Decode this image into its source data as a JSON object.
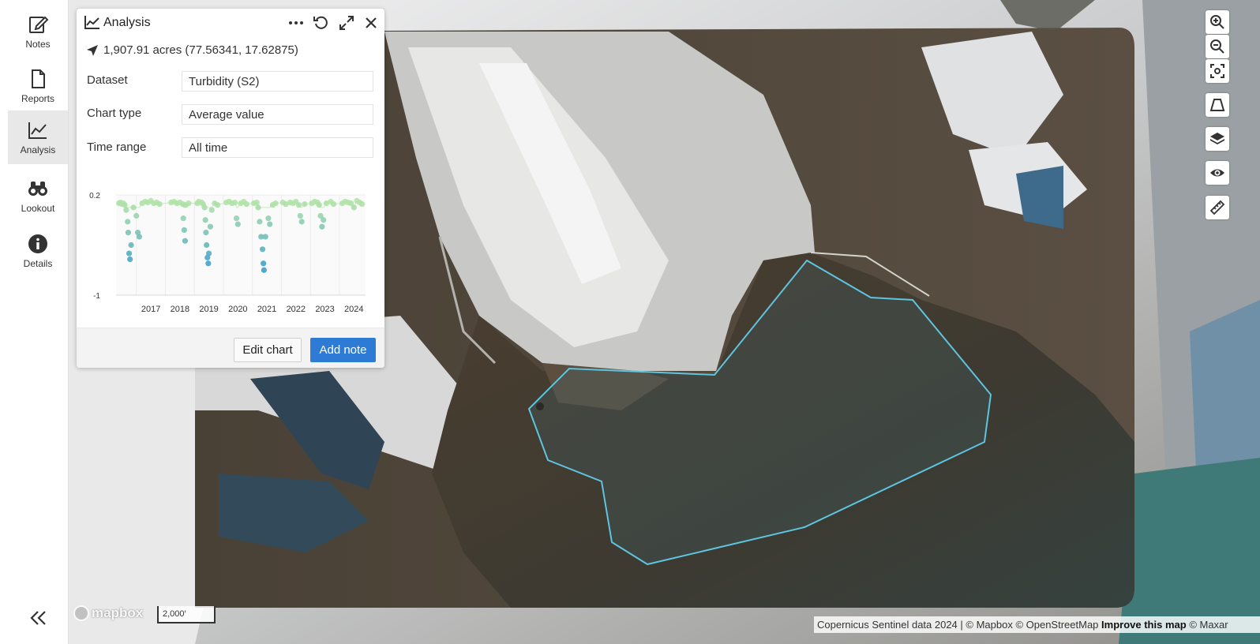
{
  "nav": {
    "items": [
      {
        "label": "Notes",
        "icon": "notes-icon"
      },
      {
        "label": "Reports",
        "icon": "report-icon"
      },
      {
        "label": "Analysis",
        "icon": "chart-line-icon",
        "active": true
      },
      {
        "label": "Lookout",
        "icon": "binoculars-icon"
      },
      {
        "label": "Details",
        "icon": "info-icon"
      }
    ],
    "collapse_icon": "double-chevron-left-icon"
  },
  "panel": {
    "title": "Analysis",
    "area_text": "1,907.91 acres (77.56341, 17.62875)",
    "fields": [
      {
        "label": "Dataset",
        "value": "Turbidity (S2)"
      },
      {
        "label": "Chart type",
        "value": "Average value"
      },
      {
        "label": "Time range",
        "value": "All time"
      }
    ],
    "edit_chart_label": "Edit chart",
    "add_note_label": "Add note",
    "header_icons": [
      "more-icon",
      "reset-icon",
      "expand-icon",
      "close-icon"
    ]
  },
  "chart_data": {
    "type": "scatter",
    "title": "",
    "xlabel": "",
    "ylabel": "",
    "ylim": [
      -1,
      0.2
    ],
    "xlim": [
      2016.3,
      2024.9
    ],
    "y_ticks": [
      "0.2",
      "-1"
    ],
    "x_ticks": [
      "2017",
      "2018",
      "2019",
      "2020",
      "2021",
      "2022",
      "2023",
      "2024"
    ],
    "colors": {
      "high": "#b7e6a6",
      "low": "#3ea0c9",
      "grid": "#ececec"
    },
    "grid": true,
    "points": [
      {
        "x": 2016.4,
        "y": 0.1
      },
      {
        "x": 2016.45,
        "y": 0.11
      },
      {
        "x": 2016.5,
        "y": 0.09
      },
      {
        "x": 2016.55,
        "y": 0.1
      },
      {
        "x": 2016.6,
        "y": 0.08
      },
      {
        "x": 2016.65,
        "y": 0.02
      },
      {
        "x": 2016.7,
        "y": -0.12
      },
      {
        "x": 2016.72,
        "y": -0.25
      },
      {
        "x": 2016.75,
        "y": -0.5
      },
      {
        "x": 2016.78,
        "y": -0.57
      },
      {
        "x": 2016.82,
        "y": -0.4
      },
      {
        "x": 2016.9,
        "y": 0.05
      },
      {
        "x": 2017.0,
        "y": -0.05
      },
      {
        "x": 2017.05,
        "y": -0.25
      },
      {
        "x": 2017.1,
        "y": -0.3
      },
      {
        "x": 2017.2,
        "y": 0.1
      },
      {
        "x": 2017.3,
        "y": 0.12
      },
      {
        "x": 2017.4,
        "y": 0.11
      },
      {
        "x": 2017.5,
        "y": 0.13
      },
      {
        "x": 2017.6,
        "y": 0.1
      },
      {
        "x": 2017.7,
        "y": 0.11
      },
      {
        "x": 2017.8,
        "y": 0.09
      },
      {
        "x": 2018.2,
        "y": 0.11
      },
      {
        "x": 2018.3,
        "y": 0.12
      },
      {
        "x": 2018.4,
        "y": 0.1
      },
      {
        "x": 2018.5,
        "y": 0.11
      },
      {
        "x": 2018.6,
        "y": 0.09
      },
      {
        "x": 2018.62,
        "y": -0.08
      },
      {
        "x": 2018.65,
        "y": -0.22
      },
      {
        "x": 2018.68,
        "y": -0.35
      },
      {
        "x": 2018.7,
        "y": 0.08
      },
      {
        "x": 2018.8,
        "y": 0.1
      },
      {
        "x": 2019.1,
        "y": 0.1
      },
      {
        "x": 2019.15,
        "y": 0.12
      },
      {
        "x": 2019.25,
        "y": 0.11
      },
      {
        "x": 2019.3,
        "y": 0.09
      },
      {
        "x": 2019.35,
        "y": 0.05
      },
      {
        "x": 2019.38,
        "y": -0.1
      },
      {
        "x": 2019.4,
        "y": -0.25
      },
      {
        "x": 2019.42,
        "y": -0.4
      },
      {
        "x": 2019.45,
        "y": -0.55
      },
      {
        "x": 2019.48,
        "y": -0.62
      },
      {
        "x": 2019.5,
        "y": -0.5
      },
      {
        "x": 2019.55,
        "y": -0.18
      },
      {
        "x": 2019.6,
        "y": 0.02
      },
      {
        "x": 2019.7,
        "y": 0.1
      },
      {
        "x": 2019.8,
        "y": 0.08
      },
      {
        "x": 2020.1,
        "y": 0.11
      },
      {
        "x": 2020.2,
        "y": 0.12
      },
      {
        "x": 2020.3,
        "y": 0.1
      },
      {
        "x": 2020.4,
        "y": 0.11
      },
      {
        "x": 2020.45,
        "y": -0.08
      },
      {
        "x": 2020.5,
        "y": -0.15
      },
      {
        "x": 2020.6,
        "y": 0.1
      },
      {
        "x": 2020.7,
        "y": 0.12
      },
      {
        "x": 2020.8,
        "y": 0.09
      },
      {
        "x": 2021.05,
        "y": 0.1
      },
      {
        "x": 2021.15,
        "y": 0.11
      },
      {
        "x": 2021.2,
        "y": 0.05
      },
      {
        "x": 2021.25,
        "y": -0.12
      },
      {
        "x": 2021.3,
        "y": -0.3
      },
      {
        "x": 2021.35,
        "y": -0.45
      },
      {
        "x": 2021.38,
        "y": -0.62
      },
      {
        "x": 2021.4,
        "y": -0.7
      },
      {
        "x": 2021.45,
        "y": -0.3
      },
      {
        "x": 2021.55,
        "y": -0.08
      },
      {
        "x": 2021.6,
        "y": -0.15
      },
      {
        "x": 2021.7,
        "y": 0.08
      },
      {
        "x": 2021.8,
        "y": 0.1
      },
      {
        "x": 2022.05,
        "y": 0.11
      },
      {
        "x": 2022.15,
        "y": 0.09
      },
      {
        "x": 2022.3,
        "y": 0.11
      },
      {
        "x": 2022.4,
        "y": 0.1
      },
      {
        "x": 2022.5,
        "y": 0.12
      },
      {
        "x": 2022.6,
        "y": 0.08
      },
      {
        "x": 2022.65,
        "y": -0.05
      },
      {
        "x": 2022.7,
        "y": -0.12
      },
      {
        "x": 2022.8,
        "y": 0.09
      },
      {
        "x": 2023.05,
        "y": 0.1
      },
      {
        "x": 2023.15,
        "y": 0.12
      },
      {
        "x": 2023.25,
        "y": 0.11
      },
      {
        "x": 2023.3,
        "y": 0.08
      },
      {
        "x": 2023.35,
        "y": -0.05
      },
      {
        "x": 2023.4,
        "y": -0.18
      },
      {
        "x": 2023.45,
        "y": -0.1
      },
      {
        "x": 2023.55,
        "y": 0.1
      },
      {
        "x": 2023.7,
        "y": 0.12
      },
      {
        "x": 2023.8,
        "y": 0.09
      },
      {
        "x": 2024.1,
        "y": 0.1
      },
      {
        "x": 2024.2,
        "y": 0.12
      },
      {
        "x": 2024.3,
        "y": 0.11
      },
      {
        "x": 2024.4,
        "y": 0.1
      },
      {
        "x": 2024.5,
        "y": 0.05
      },
      {
        "x": 2024.6,
        "y": 0.13
      },
      {
        "x": 2024.7,
        "y": 0.11
      },
      {
        "x": 2024.78,
        "y": 0.09
      }
    ]
  },
  "map": {
    "polygon_color": "#5ec4e0",
    "toolbar": [
      {
        "icon": "zoom-in-icon"
      },
      {
        "icon": "zoom-out-icon"
      },
      {
        "icon": "fit-bounds-icon"
      },
      {
        "icon": "perspective-icon"
      },
      {
        "icon": "layers-icon"
      },
      {
        "icon": "eye-icon"
      },
      {
        "icon": "ruler-icon"
      }
    ],
    "scale_label": "2,000′",
    "logo": "mapbox",
    "attribution": "Copernicus Sentinel data 2024 | © Mapbox © OpenStreetMap",
    "improve_link": "Improve this map",
    "attribution_suffix": "© Maxar"
  }
}
